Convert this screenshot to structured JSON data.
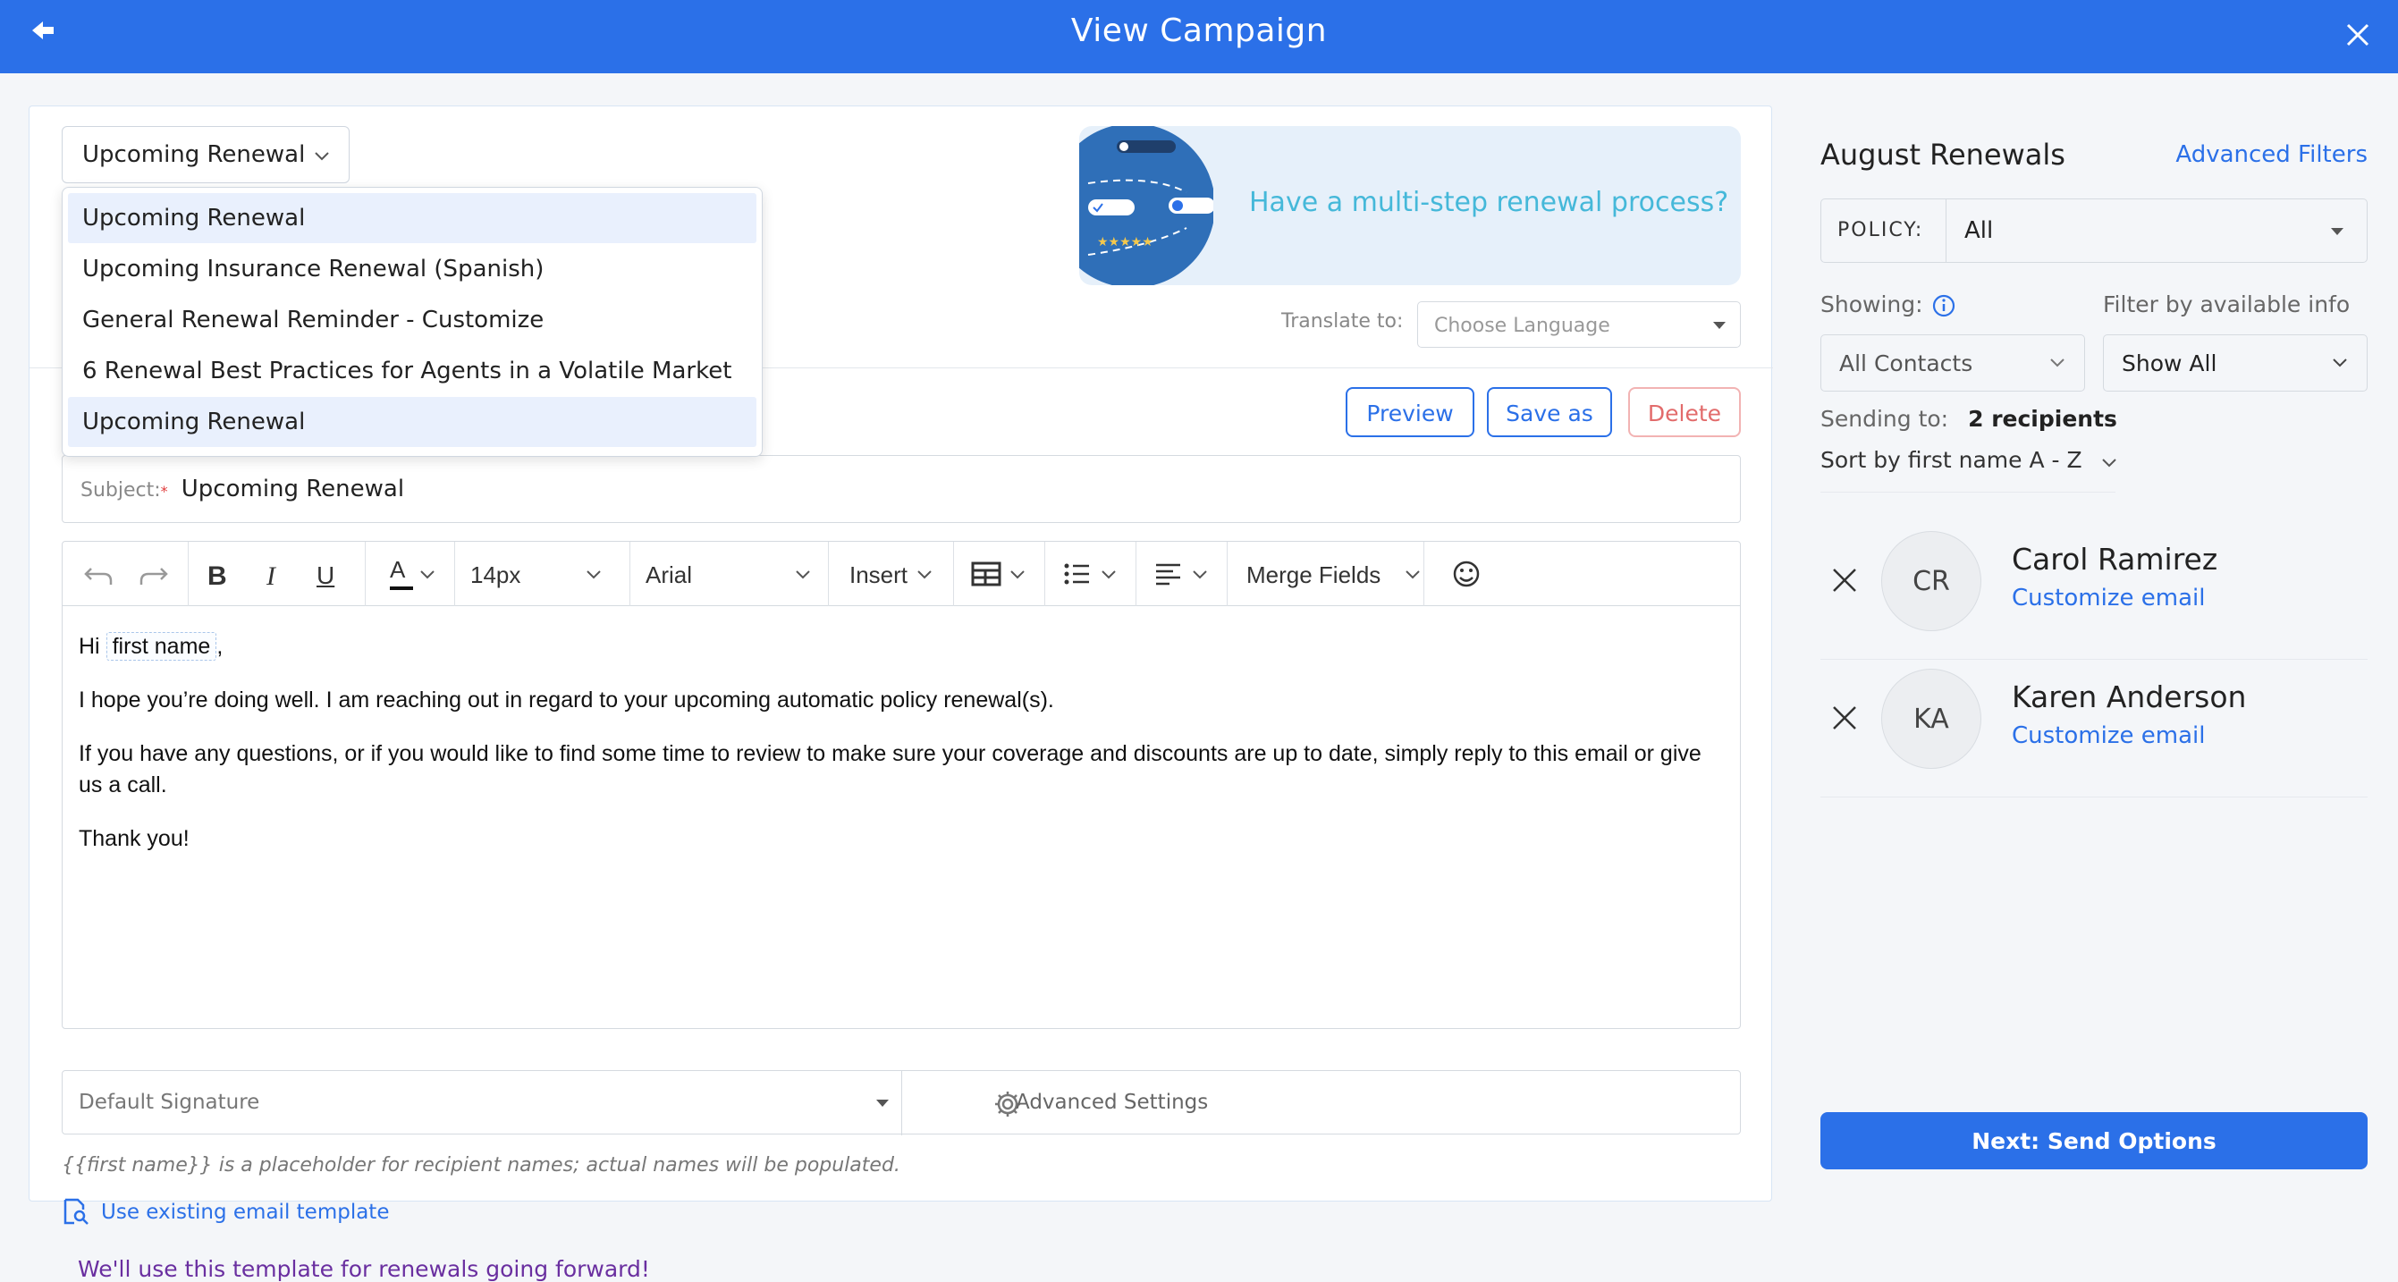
{
  "header": {
    "title": "View Campaign"
  },
  "template": {
    "selected": "Upcoming Renewal",
    "options": [
      "Upcoming Renewal",
      "Upcoming Insurance Renewal (Spanish)",
      "General Renewal Reminder - Customize",
      "6 Renewal Best Practices for Agents in a Volatile Market",
      "Upcoming Renewal"
    ]
  },
  "banner": {
    "text": "Have a multi-step renewal process?"
  },
  "translate": {
    "label": "Translate to:",
    "placeholder": "Choose Language"
  },
  "actions": {
    "preview": "Preview",
    "save_as": "Save as",
    "delete": "Delete"
  },
  "subject": {
    "label": "Subject:",
    "required": "*",
    "value": "Upcoming Renewal"
  },
  "toolbar": {
    "font_size": "14px",
    "font_family": "Arial",
    "insert": "Insert",
    "merge_fields": "Merge Fields"
  },
  "body": {
    "greeting": "Hi",
    "merge_chip": "first name",
    "greeting_comma": ",",
    "p1": "I hope you’re doing well. I am reaching out in regard to your upcoming automatic policy renewal(s).",
    "p2": "If you have any questions, or if you would like to find some time to review to make sure your coverage and discounts are up to date, simply reply to this email or give us a call.",
    "p3": "Thank you!"
  },
  "signature": {
    "value": "Default Signature",
    "advanced": "Advanced Settings"
  },
  "hint": "{{first name}} is a placeholder for recipient names; actual names will be populated.",
  "use_template": "Use existing email template",
  "going_forward": "We'll use this template for renewals going forward!",
  "sidebar": {
    "title": "August Renewals",
    "advanced_filters": "Advanced Filters",
    "policy_label": "POLICY:",
    "policy_value": "All",
    "showing_label": "Showing:",
    "showing_value": "All Contacts",
    "filter_label": "Filter by available info",
    "filter_value": "Show All",
    "sending_label": "Sending to:",
    "sending_value": "2 recipients",
    "sort": "Sort by first name A - Z",
    "recipients": [
      {
        "initials": "CR",
        "name": "Carol Ramirez",
        "action": "Customize email"
      },
      {
        "initials": "KA",
        "name": "Karen Anderson",
        "action": "Customize email"
      }
    ],
    "next": "Next: Send Options"
  },
  "colors": {
    "brand": "#2b70e8",
    "banner_text": "#45b8d9",
    "delete": "#e26b6b",
    "purple_note": "#6a2fa0"
  }
}
